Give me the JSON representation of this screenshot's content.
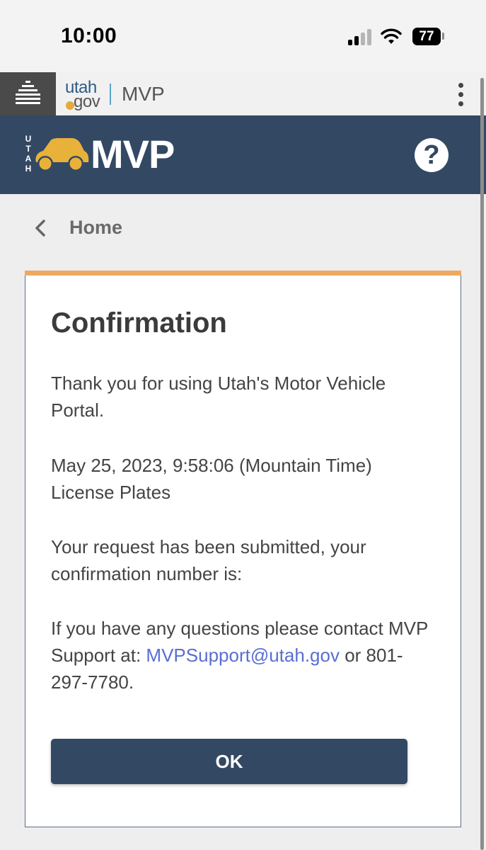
{
  "status_bar": {
    "time": "10:00",
    "battery": "77"
  },
  "gov_header": {
    "logo_top": "utah",
    "logo_bottom": "gov",
    "title": "MVP"
  },
  "app_bar": {
    "state_vertical": [
      "U",
      "T",
      "A",
      "H"
    ],
    "logo_text": "MVP",
    "help_label": "?"
  },
  "breadcrumb": {
    "label": "Home"
  },
  "card": {
    "title": "Confirmation",
    "thanks": "Thank you for using Utah's Motor Vehicle Portal.",
    "timestamp": "May 25, 2023, 9:58:06 (Mountain Time)",
    "service": "License Plates",
    "submitted": "Your request has been submitted, your confirmation number is:",
    "contact_prefix": "If you have any questions please contact MVP Support at: ",
    "contact_email": "MVPSupport@utah.gov",
    "contact_suffix": " or 801-297-7780.",
    "ok_label": "OK"
  },
  "colors": {
    "app_bar": "#334863",
    "accent": "#eea95f",
    "link": "#5a6ed2",
    "logo_car": "#e8b23a"
  }
}
